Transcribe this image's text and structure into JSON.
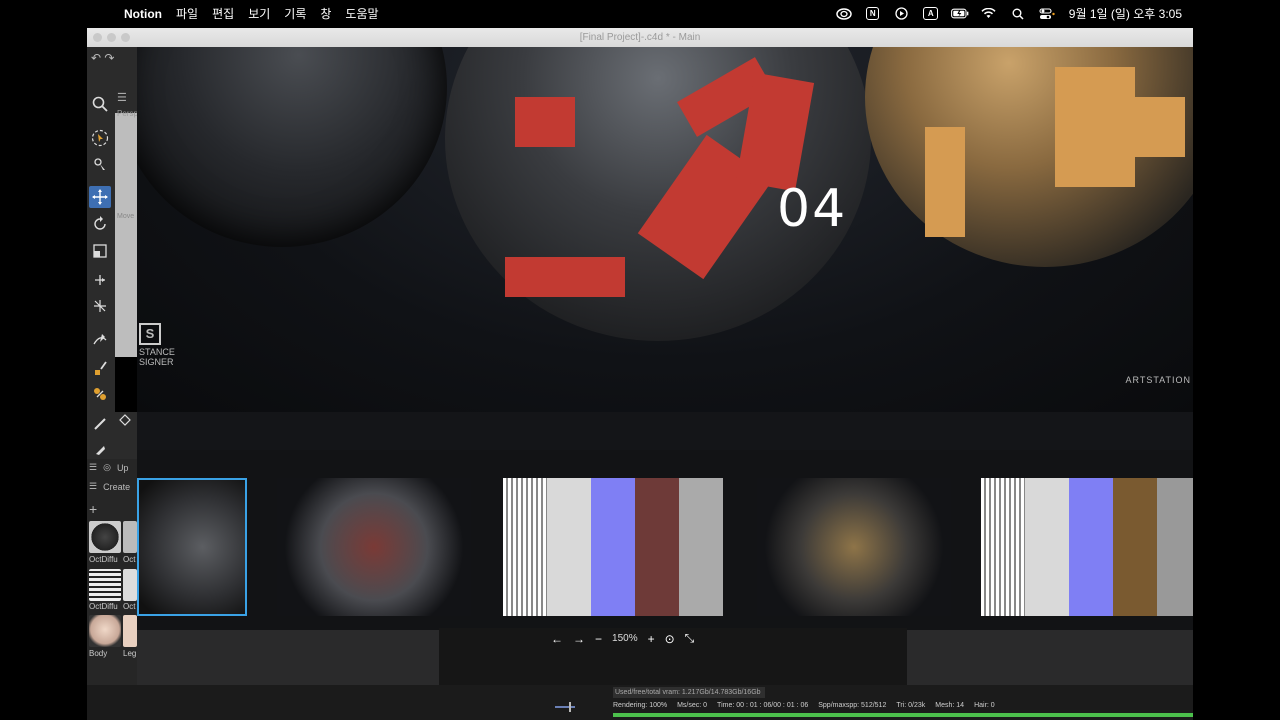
{
  "menubar": {
    "app_name": "Notion",
    "menus": [
      "파일",
      "편집",
      "보기",
      "기록",
      "창",
      "도움말"
    ],
    "clock": "9월 1일 (일) 오후 3:05",
    "notion_icon_letter": "N",
    "input_icon_letter": "A"
  },
  "window": {
    "title": "[Final Project]-.c4d * - Main"
  },
  "left_panel": {
    "viewport_label": "Perspe",
    "move_label": "Move",
    "upd_label": "Up",
    "create_label": "Create",
    "materials": [
      {
        "name": "OctDiffu"
      },
      {
        "name": "Oct"
      },
      {
        "name": "OctDiffu"
      },
      {
        "name": "Oct"
      },
      {
        "name": "Body"
      },
      {
        "name": "Leg"
      }
    ]
  },
  "viewer": {
    "hero_number": "04",
    "left_logo": "STANCE\nSIGNER",
    "logo_letter": "S",
    "right_logo": "ARTSTATION",
    "zoom": "150%",
    "selected_thumb_index": 0
  },
  "status": {
    "used_memory": "Used/free/total vram: 1.217Gb/14.783Gb/16Gb",
    "rendering": "Rendering: 100%",
    "ms_sec": "Ms/sec: 0",
    "time": "Time: 00 : 01 : 06/00 : 01 : 06",
    "spp": "Spp/maxspp: 512/512",
    "tri": "Tri: 0/23k",
    "mesh": "Mesh: 14",
    "hair": "Hair: 0",
    "progress_percent": 100
  },
  "colors": {
    "selection_blue": "#3aa2e6",
    "progress_green": "#4cc04c",
    "accent_red": "#c23a32",
    "accent_orange": "#d59b52"
  }
}
